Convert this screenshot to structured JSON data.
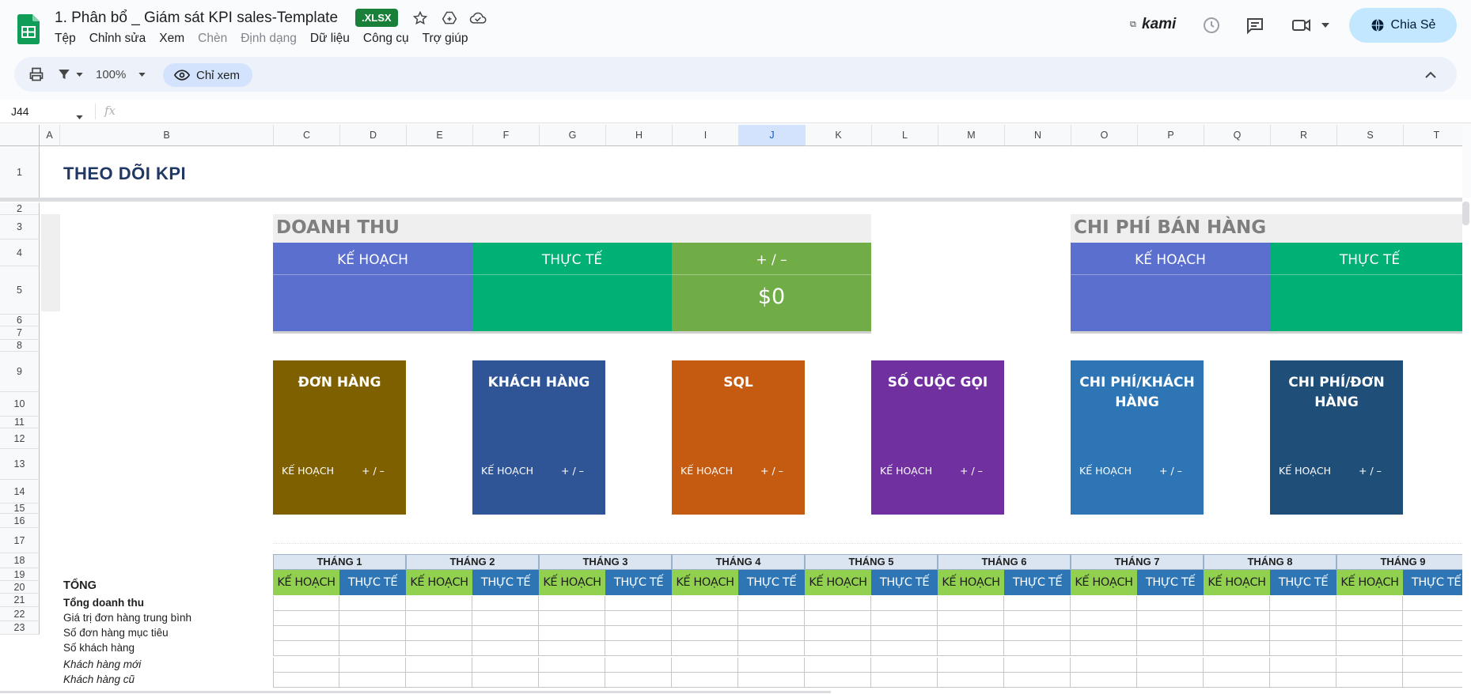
{
  "app": {
    "doc_title": "1. Phân bổ _ Giám sát KPI sales-Template",
    "format_badge": ".XLSX",
    "menu": [
      "Tệp",
      "Chỉnh sửa",
      "Xem",
      "Chèn",
      "Định dạng",
      "Dữ liệu",
      "Công cụ",
      "Trợ giúp"
    ],
    "menu_disabled": [
      false,
      false,
      false,
      true,
      true,
      false,
      false,
      false
    ],
    "kami_label": "kami",
    "share_label": "Chia Sẻ",
    "accent_color": "#c2e7ff",
    "brand_color": "#188038"
  },
  "toolbar": {
    "zoom": "100%",
    "view_mode": "Chỉ xem"
  },
  "formula_bar": {
    "cell_ref": "J44",
    "fx_label": "fx"
  },
  "columns": [
    "A",
    "B",
    "C",
    "D",
    "E",
    "F",
    "G",
    "H",
    "I",
    "J",
    "K",
    "L",
    "M",
    "N",
    "O",
    "P",
    "Q",
    "R",
    "S",
    "T"
  ],
  "selected_column": "J",
  "rows": [
    "1",
    "2",
    "3",
    "4",
    "5",
    "6",
    "7",
    "8",
    "9",
    "10",
    "11",
    "12",
    "13",
    "14",
    "15",
    "16",
    "17",
    "18",
    "19",
    "20",
    "21",
    "22",
    "23"
  ],
  "sheet": {
    "title": "THEO DÕI KPI",
    "revenue": {
      "heading": "DOANH THU",
      "plan_label": "KẾ HOẠCH",
      "actual_label": "THỰC TẾ",
      "diff_label": "+ / –",
      "diff_value": "$0",
      "colors": {
        "plan": "#5b6fcf",
        "actual": "#00b074",
        "diff": "#70ad47"
      }
    },
    "sales_cost": {
      "heading": "CHI PHÍ BÁN HÀNG",
      "plan_label": "KẾ HOẠCH",
      "actual_label": "THỰC TẾ",
      "colors": {
        "plan": "#5b6fcf",
        "actual": "#00b074"
      }
    },
    "tiles": [
      {
        "title": "ĐƠN HÀNG",
        "plan": "KẾ HOẠCH",
        "diff": "+ / –",
        "color": "#7f6000"
      },
      {
        "title": "KHÁCH HÀNG",
        "plan": "KẾ HOẠCH",
        "diff": "+ / –",
        "color": "#2f5597"
      },
      {
        "title": "SQL",
        "plan": "KẾ HOẠCH",
        "diff": "+ / –",
        "color": "#c55a11"
      },
      {
        "title": "SỐ CUỘC GỌI",
        "plan": "KẾ HOẠCH",
        "diff": "+ / –",
        "color": "#7030a0"
      },
      {
        "title": "CHI PHÍ/KHÁCH HÀNG",
        "plan": "KẾ HOẠCH",
        "diff": "+ / –",
        "color": "#2e75b6"
      },
      {
        "title": "CHI PHÍ/ĐƠN HÀNG",
        "plan": "KẾ HOẠCH",
        "diff": "+ / –",
        "color": "#1f4e79"
      }
    ],
    "table": {
      "total_label": "TỔNG",
      "months": [
        "THÁNG 1",
        "THÁNG 2",
        "THÁNG 3",
        "THÁNG 4",
        "THÁNG 5",
        "THÁNG 6",
        "THÁNG 7",
        "THÁNG 8",
        "THÁNG 9"
      ],
      "plan_label": "KẾ HOẠCH",
      "actual_label": "THỰC TẾ",
      "row_labels": [
        {
          "text": "Tổng doanh thu",
          "style": "bold"
        },
        {
          "text": "Giá trị đơn hàng trung bình",
          "style": "normal"
        },
        {
          "text": "Số đơn hàng mục tiêu",
          "style": "normal"
        },
        {
          "text": "Số khách hàng",
          "style": "normal"
        },
        {
          "text": "Khách hàng mới",
          "style": "ital"
        },
        {
          "text": "Khách hàng cũ",
          "style": "ital"
        }
      ]
    }
  }
}
